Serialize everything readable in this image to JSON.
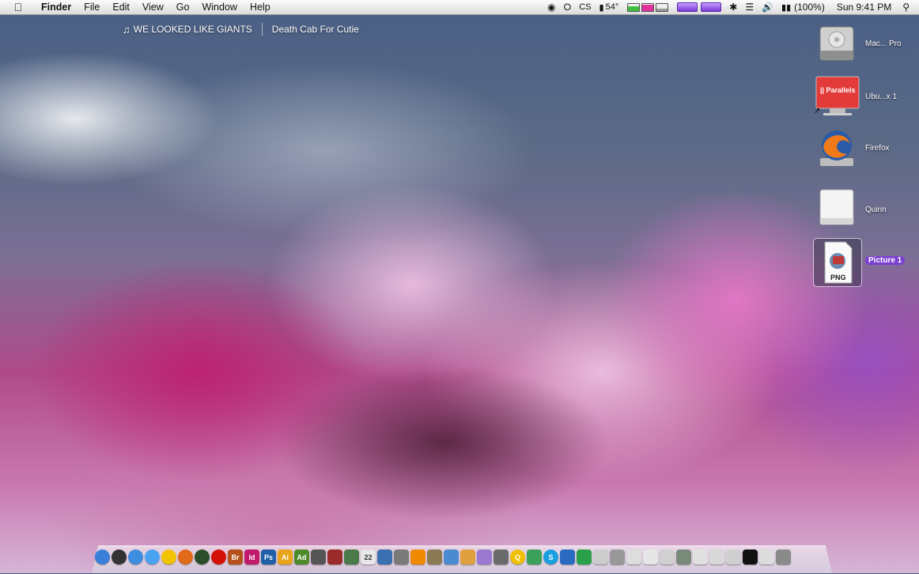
{
  "menubar": {
    "app_name": "Finder",
    "menus": [
      "File",
      "Edit",
      "View",
      "Go",
      "Window",
      "Help"
    ],
    "status": {
      "temperature": "54°",
      "battery": "(100%)",
      "clock": "Sun 9:41 PM",
      "cs_label": "CS"
    }
  },
  "now_playing": {
    "song": "WE LOOKED LIKE GIANTS",
    "artist": "Death Cab For Cutie"
  },
  "desktop_icons": [
    {
      "label": "Mac... Pro",
      "icon": "hard-drive-icon"
    },
    {
      "label": "Ubu...x 1",
      "icon": "parallels-icon",
      "inner_text": "|| Parallels"
    },
    {
      "label": "Firefox",
      "icon": "firefox-icon"
    },
    {
      "label": "Quinn",
      "icon": "external-drive-icon"
    },
    {
      "label": "Picture 1",
      "icon": "png-file-icon",
      "inner_text": "PNG",
      "selected": true
    }
  ],
  "dock": {
    "items": [
      {
        "name": "finder",
        "text": "",
        "color": "#3a7fd9"
      },
      {
        "name": "dashboard",
        "text": "",
        "color": "#333333"
      },
      {
        "name": "safari",
        "text": "",
        "color": "#3d8ee0"
      },
      {
        "name": "itunes",
        "text": "",
        "color": "#4aa3f0"
      },
      {
        "name": "adium",
        "text": "",
        "color": "#f2c400"
      },
      {
        "name": "firefox",
        "text": "",
        "color": "#e06a1a"
      },
      {
        "name": "camino",
        "text": "",
        "color": "#2a4e2a"
      },
      {
        "name": "lastfm",
        "text": "",
        "color": "#d51007"
      },
      {
        "name": "bridge",
        "text": "Br",
        "color": "#b5521c"
      },
      {
        "name": "indesign",
        "text": "Id",
        "color": "#c21a6a"
      },
      {
        "name": "photoshop",
        "text": "Ps",
        "color": "#1e5fa6"
      },
      {
        "name": "illustrator",
        "text": "Ai",
        "color": "#e8a51c"
      },
      {
        "name": "dreamweaver",
        "text": "Ad",
        "color": "#4d8a2a"
      },
      {
        "name": "aperture",
        "text": "",
        "color": "#555555"
      },
      {
        "name": "textmate",
        "text": "",
        "color": "#9b2a2a"
      },
      {
        "name": "preview",
        "text": "",
        "color": "#4a7a4a"
      },
      {
        "name": "ical",
        "text": "22",
        "color": "#e7e7e7"
      },
      {
        "name": "mail",
        "text": "",
        "color": "#3a6fb0"
      },
      {
        "name": "script-editor",
        "text": "",
        "color": "#7a7a7a"
      },
      {
        "name": "vlc",
        "text": "",
        "color": "#f08a00"
      },
      {
        "name": "utility",
        "text": "",
        "color": "#8a7a55"
      },
      {
        "name": "app-22",
        "text": "",
        "color": "#4a8ad0"
      },
      {
        "name": "app-23",
        "text": "",
        "color": "#e0a040"
      },
      {
        "name": "app-24",
        "text": "",
        "color": "#9a7ad0"
      },
      {
        "name": "app-25",
        "text": "",
        "color": "#6a6a6a"
      },
      {
        "name": "quicksilver",
        "text": "Q",
        "color": "#f0c000"
      },
      {
        "name": "app-27",
        "text": "",
        "color": "#3aa05a"
      },
      {
        "name": "skype",
        "text": "S",
        "color": "#1aa0e0"
      },
      {
        "name": "app-29",
        "text": "",
        "color": "#2a6ac0"
      },
      {
        "name": "app-30",
        "text": "",
        "color": "#2aa04a"
      },
      {
        "name": "app-31",
        "text": "",
        "color": "#cccccc"
      },
      {
        "name": "app-32",
        "text": "",
        "color": "#999999"
      },
      {
        "name": "minimized-1",
        "text": "",
        "color": "#dddddd"
      },
      {
        "name": "minimized-2",
        "text": "",
        "color": "#e6e6e6"
      },
      {
        "name": "minimized-3",
        "text": "",
        "color": "#d0d0d0"
      },
      {
        "name": "minimized-4",
        "text": "",
        "color": "#7a8a7a"
      },
      {
        "name": "minimized-5",
        "text": "",
        "color": "#e0e0e0"
      },
      {
        "name": "minimized-6",
        "text": "",
        "color": "#d8d8d8"
      },
      {
        "name": "minimized-7",
        "text": "",
        "color": "#cfcfcf"
      },
      {
        "name": "minimized-8",
        "text": "",
        "color": "#111111"
      },
      {
        "name": "minimized-9",
        "text": "",
        "color": "#dcdcdc"
      },
      {
        "name": "trash",
        "text": "",
        "color": "#8a8a8a"
      }
    ]
  }
}
